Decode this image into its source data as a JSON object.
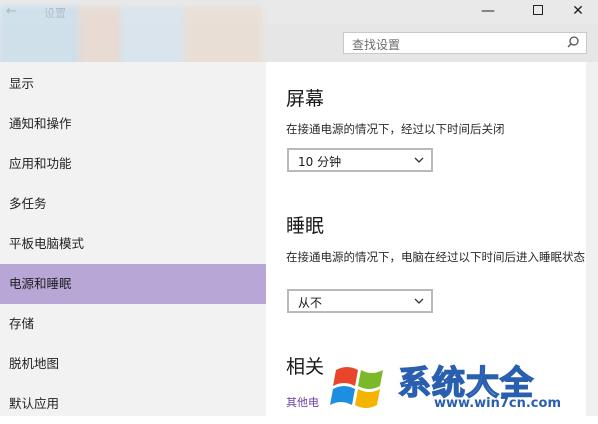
{
  "window": {
    "back_glyph": "←",
    "title": "设置",
    "minimize_glyph": "—",
    "close_glyph": "✕"
  },
  "search": {
    "placeholder": "查找设置"
  },
  "sidebar": {
    "items": [
      {
        "label": "显示"
      },
      {
        "label": "通知和操作"
      },
      {
        "label": "应用和功能"
      },
      {
        "label": "多任务"
      },
      {
        "label": "平板电脑模式"
      },
      {
        "label": "电源和睡眠",
        "active": true
      },
      {
        "label": "存储"
      },
      {
        "label": "脱机地图"
      },
      {
        "label": "默认应用"
      }
    ]
  },
  "main": {
    "screen": {
      "title": "屏幕",
      "desc": "在接通电源的情况下，经过以下时间后关闭",
      "value": "10 分钟"
    },
    "sleep": {
      "title": "睡眠",
      "desc": "在接通电源的情况下，电脑在经过以下时间后进入睡眠状态",
      "value": "从不"
    },
    "related": {
      "title": "相关",
      "link": "其他电"
    }
  },
  "watermark": {
    "text": "系统大全",
    "sub": "www.win7cn.com"
  },
  "colors": {
    "active_item": "#b8a6d6",
    "link": "#6a3fa5",
    "watermark_blue": "#2a5fb0"
  }
}
